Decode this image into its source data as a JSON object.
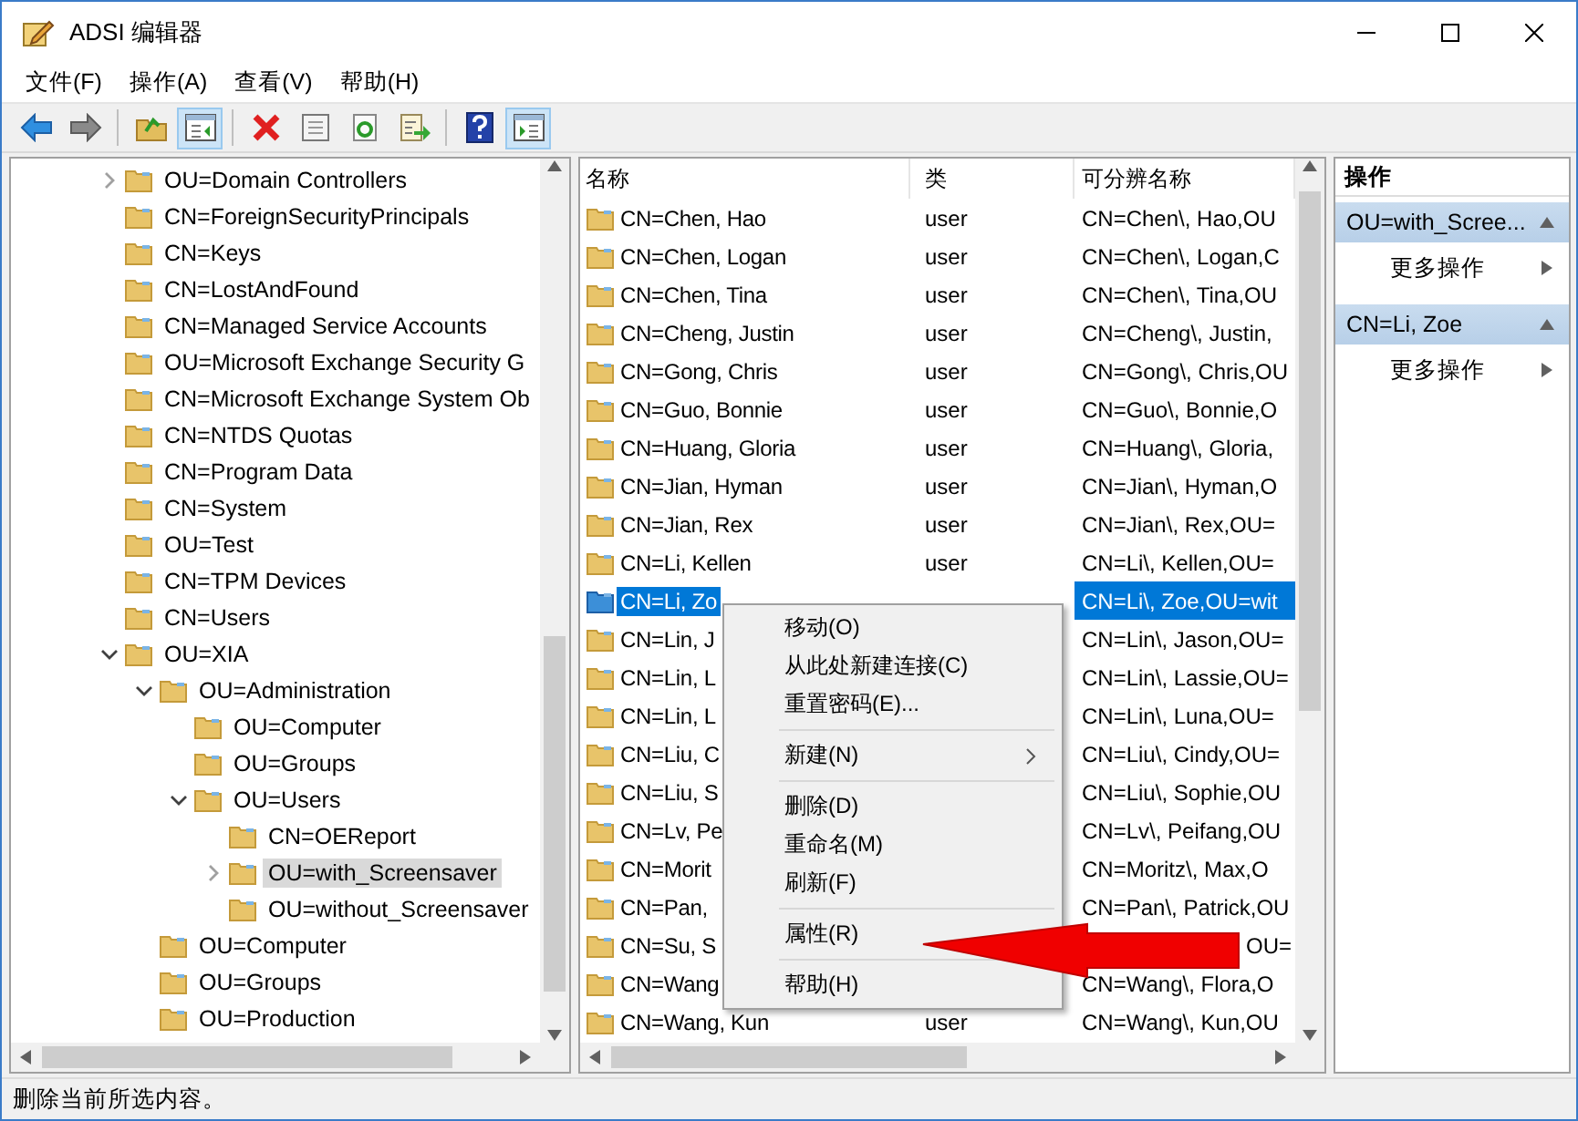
{
  "window": {
    "title": "ADSI 编辑器"
  },
  "menu": [
    "文件(F)",
    "操作(A)",
    "查看(V)",
    "帮助(H)"
  ],
  "toolbar": {
    "groups": [
      [
        {
          "kind": "back",
          "pressed": false
        },
        {
          "kind": "forward",
          "pressed": false
        }
      ],
      [
        {
          "kind": "up",
          "pressed": false
        },
        {
          "kind": "tree",
          "pressed": true
        }
      ],
      [
        {
          "kind": "delete",
          "pressed": false
        },
        {
          "kind": "properties",
          "pressed": false
        },
        {
          "kind": "refresh",
          "pressed": false
        },
        {
          "kind": "export",
          "pressed": false
        }
      ],
      [
        {
          "kind": "help",
          "pressed": false
        },
        {
          "kind": "actions",
          "pressed": true
        }
      ]
    ]
  },
  "tree": [
    {
      "label": "OU=Domain Controllers",
      "kind": "collapsed",
      "selected": false
    },
    {
      "label": "CN=ForeignSecurityPrincipals",
      "kind": "leaf",
      "selected": false
    },
    {
      "label": "CN=Keys",
      "kind": "leaf",
      "selected": false
    },
    {
      "label": "CN=LostAndFound",
      "kind": "leaf",
      "selected": false
    },
    {
      "label": "CN=Managed Service Accounts",
      "kind": "leaf",
      "selected": false
    },
    {
      "label": "OU=Microsoft Exchange Security G",
      "kind": "leaf",
      "selected": false
    },
    {
      "label": "CN=Microsoft Exchange System Ob",
      "kind": "leaf",
      "selected": false
    },
    {
      "label": "CN=NTDS Quotas",
      "kind": "leaf",
      "selected": false
    },
    {
      "label": "CN=Program Data",
      "kind": "leaf",
      "selected": false
    },
    {
      "label": "CN=System",
      "kind": "leaf",
      "selected": false
    },
    {
      "label": "OU=Test",
      "kind": "leaf",
      "selected": false
    },
    {
      "label": "CN=TPM Devices",
      "kind": "leaf",
      "selected": false
    },
    {
      "label": "CN=Users",
      "kind": "leaf",
      "selected": false
    },
    {
      "label": "OU=XIA",
      "kind": "expanded",
      "selected": false,
      "children": [
        {
          "label": "OU=Administration",
          "kind": "expanded",
          "selected": false,
          "children": [
            {
              "label": "OU=Computer",
              "kind": "leaf",
              "selected": false
            },
            {
              "label": "OU=Groups",
              "kind": "leaf",
              "selected": false
            },
            {
              "label": "OU=Users",
              "kind": "expanded",
              "selected": false,
              "children": [
                {
                  "label": "CN=OEReport",
                  "kind": "leaf",
                  "selected": false
                },
                {
                  "label": "OU=with_Screensaver",
                  "kind": "collapsed",
                  "selected": true
                },
                {
                  "label": "OU=without_Screensaver",
                  "kind": "leaf",
                  "selected": false
                }
              ]
            }
          ]
        },
        {
          "label": "OU=Computer",
          "kind": "leaf",
          "selected": false
        },
        {
          "label": "OU=Groups",
          "kind": "leaf",
          "selected": false
        },
        {
          "label": "OU=Production",
          "kind": "leaf",
          "selected": false
        }
      ]
    }
  ],
  "list": {
    "columns": [
      "名称",
      "类",
      "可分辨名称"
    ],
    "rows": [
      {
        "name": "CN=Chen, Hao",
        "type": "user",
        "dn": "CN=Chen\\, Hao,OU",
        "selected": false
      },
      {
        "name": "CN=Chen, Logan",
        "type": "user",
        "dn": "CN=Chen\\, Logan,C",
        "selected": false
      },
      {
        "name": "CN=Chen, Tina",
        "type": "user",
        "dn": "CN=Chen\\, Tina,OU",
        "selected": false
      },
      {
        "name": "CN=Cheng, Justin",
        "type": "user",
        "dn": "CN=Cheng\\, Justin,",
        "selected": false
      },
      {
        "name": "CN=Gong, Chris",
        "type": "user",
        "dn": "CN=Gong\\, Chris,OU",
        "selected": false
      },
      {
        "name": "CN=Guo, Bonnie",
        "type": "user",
        "dn": "CN=Guo\\, Bonnie,O",
        "selected": false
      },
      {
        "name": "CN=Huang, Gloria",
        "type": "user",
        "dn": "CN=Huang\\, Gloria,",
        "selected": false
      },
      {
        "name": "CN=Jian, Hyman",
        "type": "user",
        "dn": "CN=Jian\\, Hyman,O",
        "selected": false
      },
      {
        "name": "CN=Jian, Rex",
        "type": "user",
        "dn": "CN=Jian\\, Rex,OU=",
        "selected": false
      },
      {
        "name": "CN=Li, Kellen",
        "type": "user",
        "dn": "CN=Li\\, Kellen,OU=",
        "selected": false
      },
      {
        "name": "CN=Li, Zo",
        "dn": "CN=Li\\, Zoe,OU=wit",
        "selected": true
      },
      {
        "name": "CN=Lin, J",
        "dn": "CN=Lin\\, Jason,OU=",
        "selected": false
      },
      {
        "name": "CN=Lin, L",
        "dn": "CN=Lin\\, Lassie,OU=",
        "selected": false
      },
      {
        "name": "CN=Lin, L",
        "dn": "CN=Lin\\, Luna,OU=",
        "selected": false
      },
      {
        "name": "CN=Liu, C",
        "dn": "CN=Liu\\, Cindy,OU=",
        "selected": false
      },
      {
        "name": "CN=Liu, S",
        "dn": "CN=Liu\\, Sophie,OU",
        "selected": false
      },
      {
        "name": "CN=Lv, Pe",
        "dn": "CN=Lv\\, Peifang,OU",
        "selected": false
      },
      {
        "name": "CN=Morit",
        "dn": "CN=Moritz\\, Max,O",
        "selected": false
      },
      {
        "name": "CN=Pan,",
        "dn": "CN=Pan\\, Patrick,OU",
        "selected": false
      },
      {
        "name": "CN=Su, S",
        "dn": "OU=",
        "dn_covered": true,
        "selected": false
      },
      {
        "name": "CN=Wang",
        "dn": "CN=Wang\\, Flora,O",
        "selected": false
      },
      {
        "name": "CN=Wang, Kun",
        "type": "user",
        "dn": "CN=Wang\\, Kun,OU",
        "selected": false
      }
    ]
  },
  "actions": {
    "title": "操作",
    "sections": [
      {
        "title": "OU=with_Scree...",
        "items": [
          "更多操作"
        ]
      },
      {
        "title": "CN=Li, Zoe",
        "items": [
          "更多操作"
        ]
      }
    ]
  },
  "context_menu": [
    {
      "kind": "item",
      "label": "移动(O)"
    },
    {
      "kind": "item",
      "label": "从此处新建连接(C)"
    },
    {
      "kind": "item",
      "label": "重置密码(E)..."
    },
    {
      "kind": "separator"
    },
    {
      "kind": "submenu",
      "label": "新建(N)"
    },
    {
      "kind": "separator"
    },
    {
      "kind": "item",
      "label": "删除(D)"
    },
    {
      "kind": "item",
      "label": "重命名(M)"
    },
    {
      "kind": "item",
      "label": "刷新(F)"
    },
    {
      "kind": "separator"
    },
    {
      "kind": "item",
      "label": "属性(R)"
    },
    {
      "kind": "separator"
    },
    {
      "kind": "item",
      "label": "帮助(H)"
    }
  ],
  "annotation": {
    "kind": "arrow"
  },
  "status_bar": "删除当前所选内容。"
}
